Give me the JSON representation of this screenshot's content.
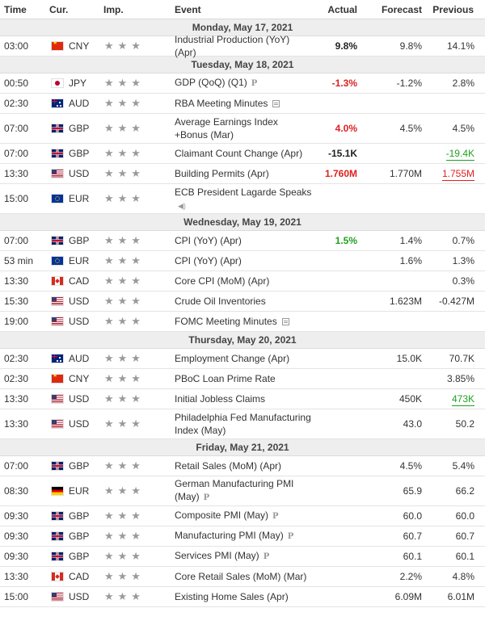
{
  "header": {
    "time": "Time",
    "cur": "Cur.",
    "imp": "Imp.",
    "event": "Event",
    "actual": "Actual",
    "forecast": "Forecast",
    "previous": "Previous"
  },
  "colors": {
    "better": "#20a020",
    "worse": "#e02020",
    "importance_star": "#9a9a9a",
    "day_header_bg": "#eeeeee"
  },
  "importance_icon": "star-icon",
  "days": [
    {
      "date": "Monday, May 17, 2021",
      "events": [
        {
          "time": "03:00",
          "flag": "CN",
          "cur": "CNY",
          "stars": "★★★",
          "event": "Industrial Production (YoY) (Apr)",
          "icon": "",
          "actual": "9.8%",
          "actual_class": "neutral",
          "forecast": "9.8%",
          "previous": "14.1%",
          "prev_class": "",
          "tall": false
        }
      ]
    },
    {
      "date": "Tuesday, May 18, 2021",
      "events": [
        {
          "time": "00:50",
          "flag": "JP",
          "cur": "JPY",
          "stars": "★★★",
          "event": "GDP (QoQ) (Q1)",
          "icon": "preliminary",
          "actual": "-1.3%",
          "actual_class": "red",
          "forecast": "-1.2%",
          "previous": "2.8%",
          "prev_class": "",
          "tall": false
        },
        {
          "time": "02:30",
          "flag": "AU",
          "cur": "AUD",
          "stars": "★★★",
          "event": "RBA Meeting Minutes",
          "icon": "doc",
          "actual": "",
          "actual_class": "",
          "forecast": "",
          "previous": "",
          "prev_class": "",
          "tall": false
        },
        {
          "time": "07:00",
          "flag": "GB",
          "cur": "GBP",
          "stars": "★★★",
          "event": "Average Earnings Index +Bonus (Mar)",
          "icon": "",
          "actual": "4.0%",
          "actual_class": "red",
          "forecast": "4.5%",
          "previous": "4.5%",
          "prev_class": "",
          "tall": true
        },
        {
          "time": "07:00",
          "flag": "GB",
          "cur": "GBP",
          "stars": "★★★",
          "event": "Claimant Count Change (Apr)",
          "icon": "",
          "actual": "-15.1K",
          "actual_class": "neutral",
          "forecast": "",
          "previous": "-19.4K",
          "prev_class": "ul-green",
          "tall": false
        },
        {
          "time": "13:30",
          "flag": "US",
          "cur": "USD",
          "stars": "★★★",
          "event": "Building Permits (Apr)",
          "icon": "",
          "actual": "1.760M",
          "actual_class": "red",
          "forecast": "1.770M",
          "previous": "1.755M",
          "prev_class": "ul-red",
          "tall": false
        },
        {
          "time": "15:00",
          "flag": "EU",
          "cur": "EUR",
          "stars": "★★★",
          "event": "ECB President Lagarde Speaks",
          "icon": "speaker",
          "actual": "",
          "actual_class": "",
          "forecast": "",
          "previous": "",
          "prev_class": "",
          "tall": true
        }
      ]
    },
    {
      "date": "Wednesday, May 19, 2021",
      "events": [
        {
          "time": "07:00",
          "flag": "GB",
          "cur": "GBP",
          "stars": "★★★",
          "event": "CPI (YoY) (Apr)",
          "icon": "",
          "actual": "1.5%",
          "actual_class": "green",
          "forecast": "1.4%",
          "previous": "0.7%",
          "prev_class": "",
          "tall": false
        },
        {
          "time": "53 min",
          "flag": "EU",
          "cur": "EUR",
          "stars": "★★★",
          "event": "CPI (YoY) (Apr)",
          "icon": "",
          "actual": "",
          "actual_class": "",
          "forecast": "1.6%",
          "previous": "1.3%",
          "prev_class": "",
          "tall": false
        },
        {
          "time": "13:30",
          "flag": "CA",
          "cur": "CAD",
          "stars": "★★★",
          "event": "Core CPI (MoM) (Apr)",
          "icon": "",
          "actual": "",
          "actual_class": "",
          "forecast": "",
          "previous": "0.3%",
          "prev_class": "",
          "tall": false
        },
        {
          "time": "15:30",
          "flag": "US",
          "cur": "USD",
          "stars": "★★★",
          "event": "Crude Oil Inventories",
          "icon": "",
          "actual": "",
          "actual_class": "",
          "forecast": "1.623M",
          "previous": "-0.427M",
          "prev_class": "",
          "tall": false
        },
        {
          "time": "19:00",
          "flag": "US",
          "cur": "USD",
          "stars": "★★★",
          "event": "FOMC Meeting Minutes",
          "icon": "doc",
          "actual": "",
          "actual_class": "",
          "forecast": "",
          "previous": "",
          "prev_class": "",
          "tall": false
        }
      ]
    },
    {
      "date": "Thursday, May 20, 2021",
      "events": [
        {
          "time": "02:30",
          "flag": "AU",
          "cur": "AUD",
          "stars": "★★★",
          "event": "Employment Change (Apr)",
          "icon": "",
          "actual": "",
          "actual_class": "",
          "forecast": "15.0K",
          "previous": "70.7K",
          "prev_class": "",
          "tall": false
        },
        {
          "time": "02:30",
          "flag": "CN",
          "cur": "CNY",
          "stars": "★★★",
          "event": "PBoC Loan Prime Rate",
          "icon": "",
          "actual": "",
          "actual_class": "",
          "forecast": "",
          "previous": "3.85%",
          "prev_class": "",
          "tall": false
        },
        {
          "time": "13:30",
          "flag": "US",
          "cur": "USD",
          "stars": "★★★",
          "event": "Initial Jobless Claims",
          "icon": "",
          "actual": "",
          "actual_class": "",
          "forecast": "450K",
          "previous": "473K",
          "prev_class": "ul-green",
          "tall": false
        },
        {
          "time": "13:30",
          "flag": "US",
          "cur": "USD",
          "stars": "★★★",
          "event": "Philadelphia Fed Manufacturing Index (May)",
          "icon": "",
          "actual": "",
          "actual_class": "",
          "forecast": "43.0",
          "previous": "50.2",
          "prev_class": "",
          "tall": true
        }
      ]
    },
    {
      "date": "Friday, May 21, 2021",
      "events": [
        {
          "time": "07:00",
          "flag": "GB",
          "cur": "GBP",
          "stars": "★★★",
          "event": "Retail Sales (MoM) (Apr)",
          "icon": "",
          "actual": "",
          "actual_class": "",
          "forecast": "4.5%",
          "previous": "5.4%",
          "prev_class": "",
          "tall": false
        },
        {
          "time": "08:30",
          "flag": "DE",
          "cur": "EUR",
          "stars": "★★★",
          "event": "German Manufacturing PMI (May)",
          "icon": "preliminary",
          "actual": "",
          "actual_class": "",
          "forecast": "65.9",
          "previous": "66.2",
          "prev_class": "",
          "tall": true
        },
        {
          "time": "09:30",
          "flag": "GB",
          "cur": "GBP",
          "stars": "★★★",
          "event": "Composite PMI (May)",
          "icon": "preliminary",
          "actual": "",
          "actual_class": "",
          "forecast": "60.0",
          "previous": "60.0",
          "prev_class": "",
          "tall": false
        },
        {
          "time": "09:30",
          "flag": "GB",
          "cur": "GBP",
          "stars": "★★★",
          "event": "Manufacturing PMI (May)",
          "icon": "preliminary",
          "actual": "",
          "actual_class": "",
          "forecast": "60.7",
          "previous": "60.7",
          "prev_class": "",
          "tall": false
        },
        {
          "time": "09:30",
          "flag": "GB",
          "cur": "GBP",
          "stars": "★★★",
          "event": "Services PMI (May)",
          "icon": "preliminary",
          "actual": "",
          "actual_class": "",
          "forecast": "60.1",
          "previous": "60.1",
          "prev_class": "",
          "tall": false
        },
        {
          "time": "13:30",
          "flag": "CA",
          "cur": "CAD",
          "stars": "★★★",
          "event": "Core Retail Sales (MoM) (Mar)",
          "icon": "",
          "actual": "",
          "actual_class": "",
          "forecast": "2.2%",
          "previous": "4.8%",
          "prev_class": "",
          "tall": false
        },
        {
          "time": "15:00",
          "flag": "US",
          "cur": "USD",
          "stars": "★★★",
          "event": "Existing Home Sales (Apr)",
          "icon": "",
          "actual": "",
          "actual_class": "",
          "forecast": "6.09M",
          "previous": "6.01M",
          "prev_class": "",
          "tall": false
        }
      ]
    }
  ]
}
